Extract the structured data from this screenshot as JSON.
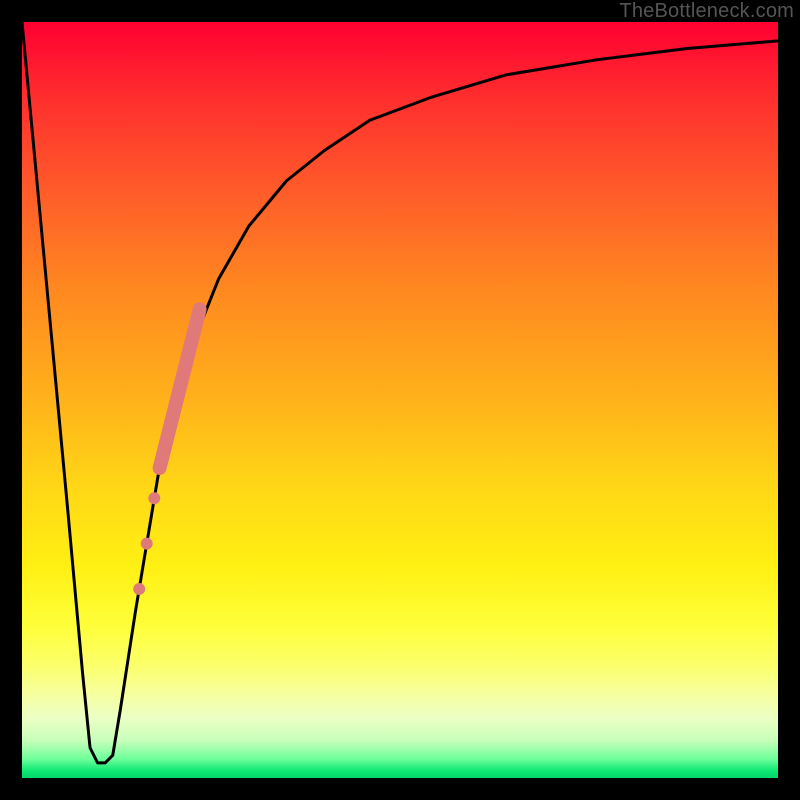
{
  "watermark": {
    "text": "TheBottleneck.com"
  },
  "chart_data": {
    "type": "line",
    "title": "",
    "xlabel": "",
    "ylabel": "",
    "xlim": [
      0,
      100
    ],
    "ylim": [
      0,
      100
    ],
    "grid": false,
    "legend": false,
    "background_gradient": {
      "stops": [
        {
          "pos": 0,
          "color": "#ff0030"
        },
        {
          "pos": 50,
          "color": "#ffb21a"
        },
        {
          "pos": 80,
          "color": "#feff3a"
        },
        {
          "pos": 100,
          "color": "#00d56a"
        }
      ]
    },
    "series": [
      {
        "name": "bottleneck-curve",
        "color": "#000000",
        "x": [
          0,
          3,
          6,
          8,
          9,
          10,
          11,
          12,
          13,
          15,
          18,
          22,
          26,
          30,
          35,
          40,
          46,
          54,
          64,
          76,
          88,
          100
        ],
        "y": [
          100,
          68,
          36,
          14,
          4,
          2,
          2,
          3,
          9,
          22,
          40,
          56,
          66,
          73,
          79,
          83,
          87,
          90,
          93,
          95,
          96.5,
          97.5
        ]
      }
    ],
    "highlight_segment": {
      "name": "highlighted-range",
      "color": "#e07a7a",
      "points": [
        {
          "x": 15.5,
          "y": 25,
          "r": 6
        },
        {
          "x": 16.5,
          "y": 31,
          "r": 6
        },
        {
          "x": 17.5,
          "y": 37,
          "r": 6
        }
      ],
      "bar": {
        "x1": 18.2,
        "y1": 41,
        "x2": 23.5,
        "y2": 62,
        "width": 14
      }
    }
  }
}
